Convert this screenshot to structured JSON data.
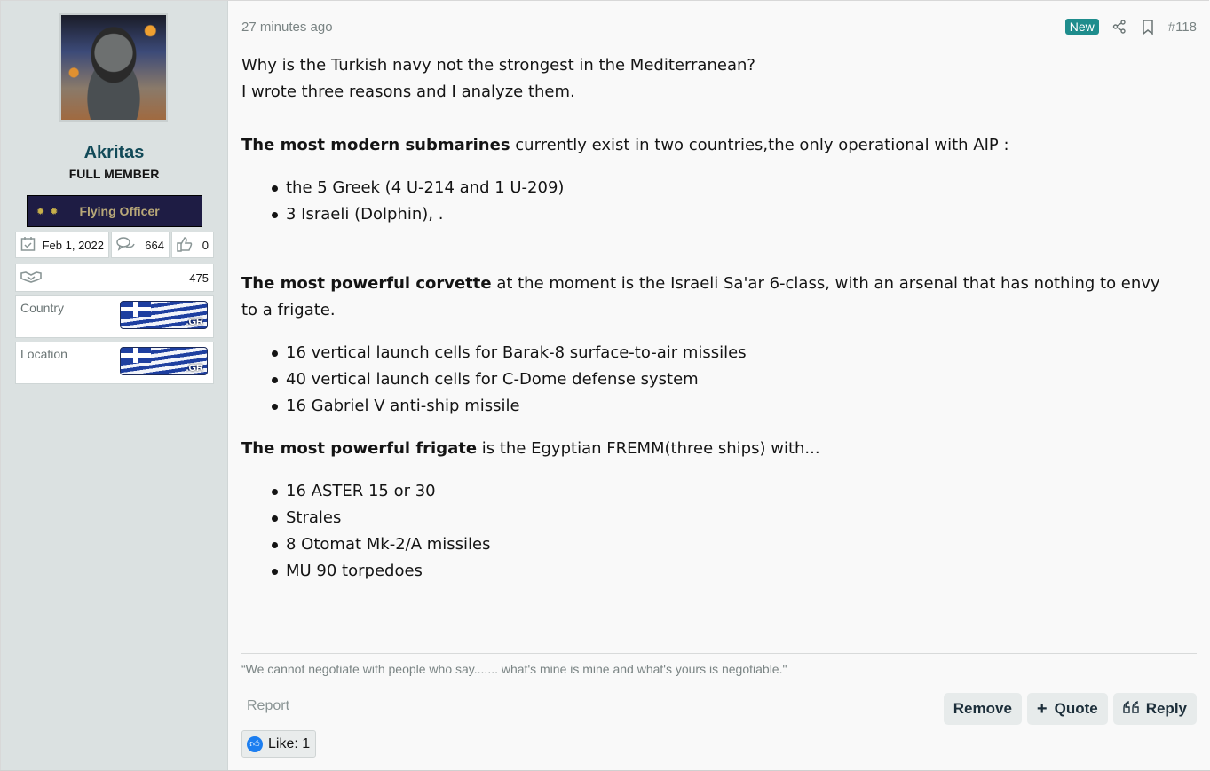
{
  "sidebar": {
    "username": "Akritas",
    "user_title": "FULL MEMBER",
    "rank_banner": {
      "stars": "✹✹",
      "label": "Flying Officer"
    },
    "stats": {
      "joined": "Feb 1, 2022",
      "messages": "664",
      "reactions": "0",
      "trophy_points": "475"
    },
    "fields": [
      {
        "label": "Country",
        "flag_tag": ".GR"
      },
      {
        "label": "Location",
        "flag_tag": ".GR"
      }
    ]
  },
  "post": {
    "time": "27 minutes ago",
    "badge": "New",
    "number": "#118",
    "intro_lines": [
      "Why is the Turkish navy not the strongest in the Mediterranean?",
      "I wrote three reasons and I analyze them."
    ],
    "sections": [
      {
        "bold": "The most modern submarines",
        "text": " currently exist in two countries,the only operational with AIP :",
        "items": [
          "the 5 Greek (4 U-214 and 1 U-209)",
          "3 Israeli (Dolphin), ."
        ]
      },
      {
        "bold": "The most powerful corvette",
        "text": " at the moment is the Israeli Sa'ar 6-class, with an arsenal that has nothing to envy to a frigate.",
        "items": [
          "16 vertical launch cells for Barak-8 surface-to-air missiles",
          "40 vertical launch cells for C-Dome defense system",
          "16 Gabriel V anti-ship missile"
        ]
      },
      {
        "bold": "The most powerful frigate",
        "text": " is the Egyptian FREMM(three ships) with...",
        "items": [
          "16 ASTER 15 or 30",
          "Strales",
          "8 Otomat Mk-2/A missiles",
          "MU 90 torpedoes"
        ]
      }
    ],
    "signature": "“We cannot negotiate with people who say....... what's mine is mine and what's yours is negotiable.\"",
    "report_label": "Report",
    "buttons": {
      "remove": "Remove",
      "quote": "Quote",
      "reply": "Reply"
    },
    "like_label": "Like: 1"
  }
}
